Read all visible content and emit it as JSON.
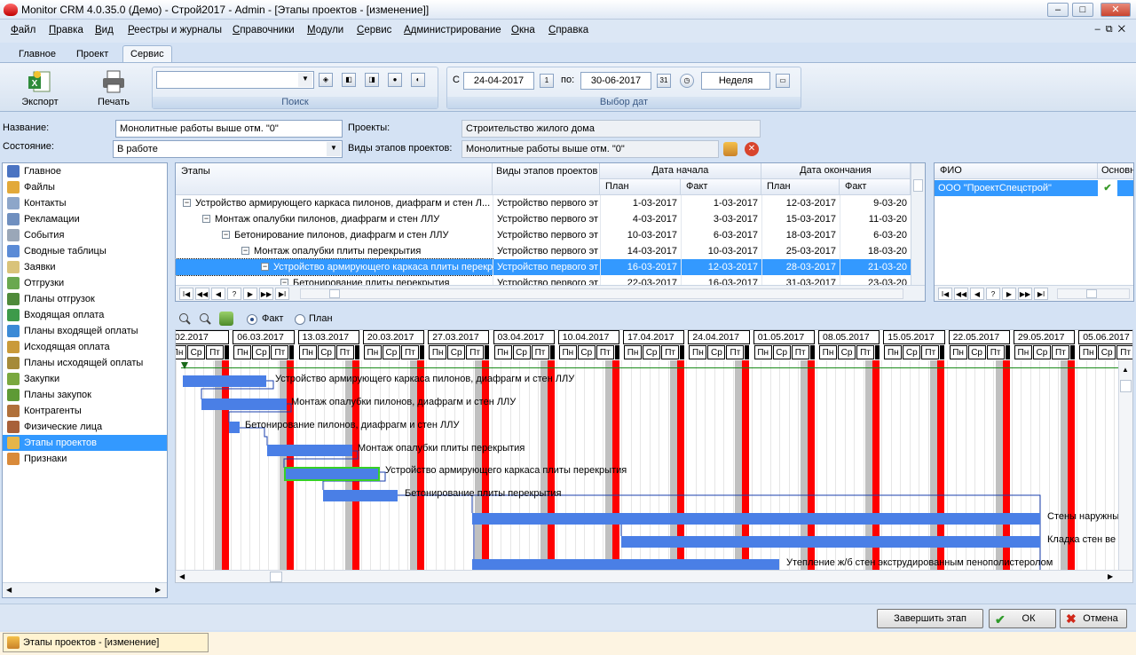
{
  "window": {
    "title": "Monitor CRM 4.0.35.0 (Демо) - Строй2017 - Admin - [Этапы проектов - [изменение]]"
  },
  "menu": [
    "Файл",
    "Правка",
    "Вид",
    "Реестры и журналы",
    "Справочники",
    "Модули",
    "Сервис",
    "Администрирование",
    "Окна",
    "Справка"
  ],
  "tabs": [
    "Главное",
    "Проект",
    "Сервис"
  ],
  "active_tab": "Сервис",
  "ribbon": {
    "export_label": "Экспорт",
    "print_label": "Печать",
    "search_group_label": "Поиск",
    "search_value": "",
    "date_group_label": "Выбор дат",
    "from_label": "С",
    "from_date": "24-04-2017",
    "to_label": "по:",
    "to_date": "30-06-2017",
    "period": "Неделя"
  },
  "form": {
    "name_label": "Название:",
    "name_value": "Монолитные работы выше отм. \"0\"",
    "state_label": "Состояние:",
    "state_value": "В работе",
    "projects_label": "Проекты:",
    "projects_value": "Строительство жилого дома",
    "stage_types_label": "Виды этапов проектов:",
    "stage_types_value": "Монолитные работы выше отм. \"0\""
  },
  "sidebar": {
    "items": [
      "Главное",
      "Файлы",
      "Контакты",
      "Рекламации",
      "События",
      "Сводные таблицы",
      "Заявки",
      "Отгрузки",
      "Планы отгрузок",
      "Входящая оплата",
      "Планы входящей оплаты",
      "Исходящая оплата",
      "Планы исходящей оплаты",
      "Закупки",
      "Планы закупок",
      "Контрагенты",
      "Физические лица",
      "Этапы проектов",
      "Признаки"
    ],
    "selected": "Этапы проектов"
  },
  "stages_grid": {
    "headers": {
      "stages": "Этапы",
      "types": "Виды этапов проектов",
      "start": "Дата начала",
      "end": "Дата окончания",
      "plan": "План",
      "fact": "Факт"
    },
    "rows": [
      {
        "name": "Устройство армирующего каркаса пилонов, диафрагм и стен Л...",
        "type": "Устройство первого эт",
        "start_plan": "1-03-2017",
        "start_fact": "1-03-2017",
        "end_plan": "12-03-2017",
        "end_fact": "9-03-20"
      },
      {
        "name": "Монтаж опалубки пилонов, диафрагм и стен ЛЛУ",
        "type": "Устройство первого эт",
        "start_plan": "4-03-2017",
        "start_fact": "3-03-2017",
        "end_plan": "15-03-2017",
        "end_fact": "11-03-20"
      },
      {
        "name": "Бетонирование пилонов, диафрагм и стен ЛЛУ",
        "type": "Устройство первого эт",
        "start_plan": "10-03-2017",
        "start_fact": "6-03-2017",
        "end_plan": "18-03-2017",
        "end_fact": "6-03-20"
      },
      {
        "name": "Монтаж опалубки плиты перекрытия",
        "type": "Устройство первого эт",
        "start_plan": "14-03-2017",
        "start_fact": "10-03-2017",
        "end_plan": "25-03-2017",
        "end_fact": "18-03-20"
      },
      {
        "name": "Устройство армирующего каркаса плиты перекр...",
        "type": "Устройство первого эт",
        "start_plan": "16-03-2017",
        "start_fact": "12-03-2017",
        "end_plan": "28-03-2017",
        "end_fact": "21-03-20"
      },
      {
        "name": "Бетонирование плиты перекрытия",
        "type": "Устройство первого эт",
        "start_plan": "22-03-2017",
        "start_fact": "16-03-2017",
        "end_plan": "31-03-2017",
        "end_fact": "23-03-20"
      }
    ]
  },
  "responsible_grid": {
    "headers": {
      "fio": "ФИО",
      "main": "Основн"
    },
    "rows": [
      {
        "fio": "ООО \"ПроектСпецстрой\"",
        "main": "✔"
      }
    ]
  },
  "gantt": {
    "mode_fact": "Факт",
    "mode_plan": "План",
    "selected_mode": "Факт",
    "weeks": [
      ".02.2017",
      "06.03.2017",
      "13.03.2017",
      "20.03.2017",
      "27.03.2017",
      "03.04.2017",
      "10.04.2017",
      "17.04.2017",
      "24.04.2017",
      "01.05.2017",
      "08.05.2017",
      "15.05.2017",
      "22.05.2017",
      "29.05.2017",
      "05.06.2017"
    ],
    "day_labels": [
      "Пн",
      "Ср",
      "Пт"
    ],
    "tasks": [
      "Устройство армирующего каркаса пилонов, диафрагм и стен ЛЛУ",
      "Монтаж опалубки пилонов, диафрагм и стен ЛЛУ",
      "Бетонирование пилонов, диафрагм и стен ЛЛУ",
      "Монтаж опалубки плиты перекрытия",
      "Устройство армирующего каркаса плиты перекрытия",
      "Бетонирование плиты перекрытия",
      "Стены наружны",
      "Кладка стен  ве",
      "Утепление ж/б стен экструдированным пенополистеролом"
    ]
  },
  "buttons": {
    "finish": "Завершить этап",
    "ok": "ОК",
    "cancel": "Отмена"
  },
  "taskbar": {
    "window": "Этапы проектов - [изменение]"
  },
  "colors": {
    "bar": "#4a7fe6",
    "weekend": "#ff0000",
    "holiday": "#c0c0c0",
    "selection": "#3399ff"
  }
}
